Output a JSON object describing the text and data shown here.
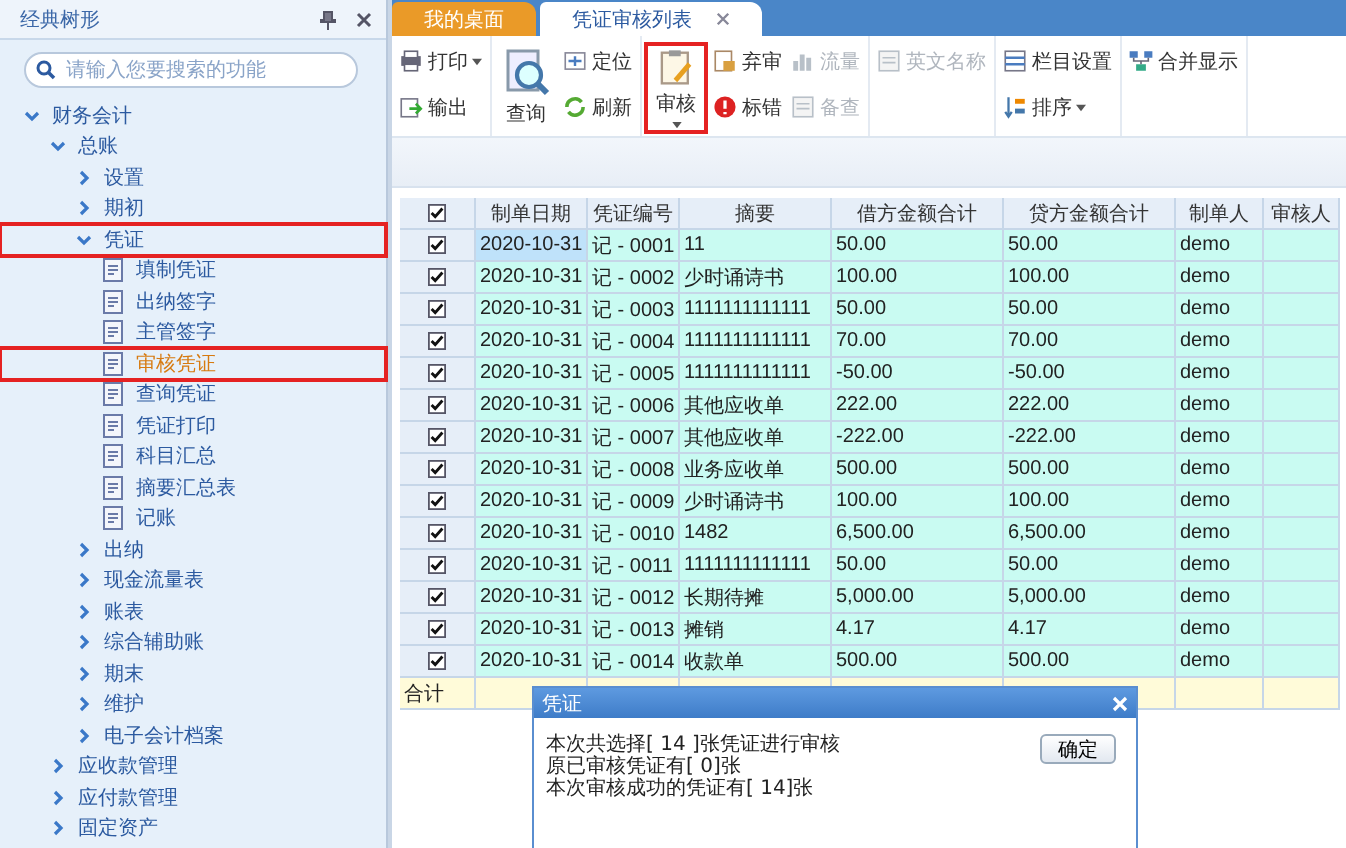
{
  "sidebar": {
    "title": "经典树形",
    "search": {
      "placeholder": "请输入您要搜索的功能"
    },
    "tree": [
      {
        "label": "财务会计",
        "expanded": true,
        "highlighted": false,
        "children": [
          {
            "label": "总账",
            "expanded": true,
            "highlighted": false,
            "children": [
              {
                "label": "设置",
                "expanded": false,
                "highlighted": false
              },
              {
                "label": "期初",
                "expanded": false,
                "highlighted": false
              },
              {
                "label": "凭证",
                "expanded": true,
                "highlighted": true,
                "children": [
                  {
                    "label": "填制凭证",
                    "kind": "leaf",
                    "selected": false,
                    "highlighted": false
                  },
                  {
                    "label": "出纳签字",
                    "kind": "leaf",
                    "selected": false,
                    "highlighted": false
                  },
                  {
                    "label": "主管签字",
                    "kind": "leaf",
                    "selected": false,
                    "highlighted": false
                  },
                  {
                    "label": "审核凭证",
                    "kind": "leaf",
                    "selected": true,
                    "highlighted": true
                  },
                  {
                    "label": "查询凭证",
                    "kind": "leaf",
                    "selected": false,
                    "highlighted": false
                  },
                  {
                    "label": "凭证打印",
                    "kind": "leaf",
                    "selected": false,
                    "highlighted": false
                  },
                  {
                    "label": "科目汇总",
                    "kind": "leaf",
                    "selected": false,
                    "highlighted": false
                  },
                  {
                    "label": "摘要汇总表",
                    "kind": "leaf",
                    "selected": false,
                    "highlighted": false
                  },
                  {
                    "label": "记账",
                    "kind": "leaf",
                    "selected": false,
                    "highlighted": false
                  }
                ]
              },
              {
                "label": "出纳",
                "expanded": false,
                "highlighted": false
              },
              {
                "label": "现金流量表",
                "expanded": false,
                "highlighted": false
              },
              {
                "label": "账表",
                "expanded": false,
                "highlighted": false
              },
              {
                "label": "综合辅助账",
                "expanded": false,
                "highlighted": false
              },
              {
                "label": "期末",
                "expanded": false,
                "highlighted": false
              },
              {
                "label": "维护",
                "expanded": false,
                "highlighted": false
              },
              {
                "label": "电子会计档案",
                "expanded": false,
                "highlighted": false
              }
            ]
          },
          {
            "label": "应收款管理",
            "expanded": false,
            "highlighted": false
          },
          {
            "label": "应付款管理",
            "expanded": false,
            "highlighted": false
          },
          {
            "label": "固定资产",
            "expanded": false,
            "highlighted": false
          }
        ]
      }
    ]
  },
  "tabs": [
    {
      "label": "我的桌面",
      "selected": false,
      "closable": false
    },
    {
      "label": "凭证审核列表",
      "selected": true,
      "closable": true
    }
  ],
  "toolbar": [
    {
      "items": [
        {
          "label": "打印",
          "kind": "small",
          "dropdown": true,
          "disabled": false,
          "highlighted": false
        },
        {
          "label": "输出",
          "kind": "small",
          "dropdown": false,
          "disabled": false,
          "highlighted": false
        }
      ]
    },
    {
      "items": [
        {
          "label": "查询",
          "kind": "large",
          "dropdown": false,
          "disabled": false,
          "highlighted": false
        },
        {
          "label": "定位",
          "kind": "small",
          "dropdown": false,
          "disabled": false,
          "highlighted": false
        },
        {
          "label": "刷新",
          "kind": "small",
          "dropdown": false,
          "disabled": false,
          "highlighted": false
        }
      ]
    },
    {
      "items": [
        {
          "label": "审核",
          "kind": "large",
          "dropdown": true,
          "disabled": false,
          "highlighted": true
        },
        {
          "label": "弃审",
          "kind": "small",
          "dropdown": false,
          "disabled": false,
          "highlighted": false
        },
        {
          "label": "标错",
          "kind": "small",
          "dropdown": false,
          "disabled": false,
          "highlighted": false
        },
        {
          "label": "流量",
          "kind": "small",
          "dropdown": false,
          "disabled": true,
          "highlighted": false
        },
        {
          "label": "备查",
          "kind": "small",
          "dropdown": false,
          "disabled": true,
          "highlighted": false
        }
      ]
    },
    {
      "items": [
        {
          "label": "英文名称",
          "kind": "small",
          "dropdown": false,
          "disabled": true,
          "highlighted": false
        }
      ]
    },
    {
      "items": [
        {
          "label": "栏目设置",
          "kind": "small",
          "dropdown": false,
          "disabled": false,
          "highlighted": false
        },
        {
          "label": "排序",
          "kind": "small",
          "dropdown": true,
          "disabled": false,
          "highlighted": false
        }
      ]
    },
    {
      "items": [
        {
          "label": "合并显示",
          "kind": "small",
          "dropdown": false,
          "disabled": false,
          "highlighted": false
        }
      ]
    }
  ],
  "table": {
    "header_checked": true,
    "columns": [
      "制单日期",
      "凭证编号",
      "摘要",
      "借方金额合计",
      "贷方金额合计",
      "制单人",
      "审核人"
    ],
    "rows": [
      {
        "checked": true,
        "current": true,
        "cells": [
          "2020-10-31",
          "记 - 0001",
          "11",
          "50.00",
          "50.00",
          "demo"
        ]
      },
      {
        "checked": true,
        "current": false,
        "cells": [
          "2020-10-31",
          "记 - 0002",
          "少时诵诗书",
          "100.00",
          "100.00",
          "demo"
        ]
      },
      {
        "checked": true,
        "current": false,
        "cells": [
          "2020-10-31",
          "记 - 0003",
          "1111111111111",
          "50.00",
          "50.00",
          "demo"
        ]
      },
      {
        "checked": true,
        "current": false,
        "cells": [
          "2020-10-31",
          "记 - 0004",
          "1111111111111",
          "70.00",
          "70.00",
          "demo"
        ]
      },
      {
        "checked": true,
        "current": false,
        "cells": [
          "2020-10-31",
          "记 - 0005",
          "1111111111111",
          "-50.00",
          "-50.00",
          "demo"
        ]
      },
      {
        "checked": true,
        "current": false,
        "cells": [
          "2020-10-31",
          "记 - 0006",
          "其他应收单",
          "222.00",
          "222.00",
          "demo"
        ]
      },
      {
        "checked": true,
        "current": false,
        "cells": [
          "2020-10-31",
          "记 - 0007",
          "其他应收单",
          "-222.00",
          "-222.00",
          "demo"
        ]
      },
      {
        "checked": true,
        "current": false,
        "cells": [
          "2020-10-31",
          "记 - 0008",
          "业务应收单",
          "500.00",
          "500.00",
          "demo"
        ]
      },
      {
        "checked": true,
        "current": false,
        "cells": [
          "2020-10-31",
          "记 - 0009",
          "少时诵诗书",
          "100.00",
          "100.00",
          "demo"
        ]
      },
      {
        "checked": true,
        "current": false,
        "cells": [
          "2020-10-31",
          "记 - 0010",
          "1482",
          "6,500.00",
          "6,500.00",
          "demo"
        ]
      },
      {
        "checked": true,
        "current": false,
        "cells": [
          "2020-10-31",
          "记 - 0011",
          "1111111111111",
          "50.00",
          "50.00",
          "demo"
        ]
      },
      {
        "checked": true,
        "current": false,
        "cells": [
          "2020-10-31",
          "记 - 0012",
          "长期待摊",
          "5,000.00",
          "5,000.00",
          "demo"
        ]
      },
      {
        "checked": true,
        "current": false,
        "cells": [
          "2020-10-31",
          "记 - 0013",
          "摊销",
          "4.17",
          "4.17",
          "demo"
        ]
      },
      {
        "checked": true,
        "current": false,
        "cells": [
          "2020-10-31",
          "记 - 0014",
          "收款单",
          "500.00",
          "500.00",
          "demo"
        ]
      }
    ],
    "footer": "合计"
  },
  "dialog": {
    "title": "凭证",
    "lines": [
      "本次共选择[ 14 ]张凭证进行审核",
      "原已审核凭证有[ 0]张",
      "本次审核成功的凭证有[ 14]张"
    ],
    "button": "确定"
  }
}
